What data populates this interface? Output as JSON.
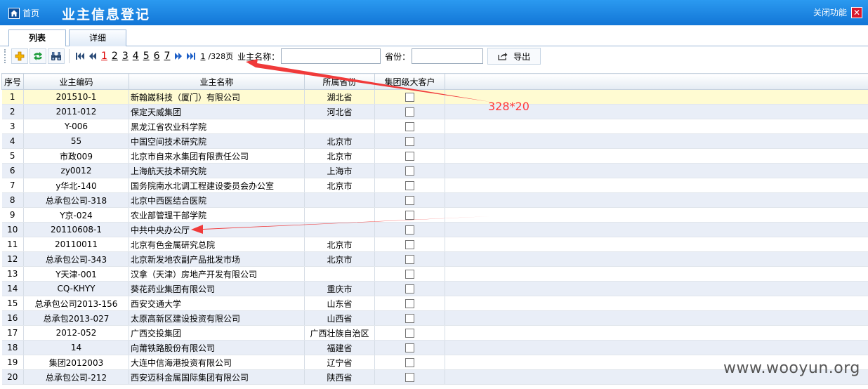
{
  "header": {
    "home_label": "首页",
    "title": "业主信息登记",
    "close_label": "关闭功能",
    "close_glyph": "✕"
  },
  "tabs": [
    {
      "label": "列表",
      "active": true
    },
    {
      "label": "详细",
      "active": false
    }
  ],
  "toolbar": {
    "pages": [
      "1",
      "2",
      "3",
      "4",
      "5",
      "6",
      "7"
    ],
    "current_page": "1",
    "total_pages_text": "/328页",
    "owner_name_label": "业主名称：",
    "owner_name_value": "",
    "province_label": "省份：",
    "province_value": "",
    "export_label": "导出"
  },
  "table": {
    "columns": [
      "序号",
      "业主编码",
      "业主名称",
      "所属省份",
      "集团级大客户"
    ],
    "rows": [
      [
        "1",
        "201510-1",
        "新翰崴科技（厦门）有限公司",
        "湖北省"
      ],
      [
        "2",
        "2011-012",
        "保定天威集团",
        "河北省"
      ],
      [
        "3",
        "Y-006",
        "黑龙江省农业科学院",
        ""
      ],
      [
        "4",
        "55",
        "中国空间技术研究院",
        "北京市"
      ],
      [
        "5",
        "市政009",
        "北京市自来水集团有限责任公司",
        "北京市"
      ],
      [
        "6",
        "zy0012",
        "上海航天技术研究院",
        "上海市"
      ],
      [
        "7",
        "y华北-140",
        "国务院南水北调工程建设委员会办公室",
        "北京市"
      ],
      [
        "8",
        "总承包公司-318",
        "北京中西医结合医院",
        ""
      ],
      [
        "9",
        "Y京-024",
        "农业部管理干部学院",
        ""
      ],
      [
        "10",
        "20110608-1",
        "中共中央办公厅",
        ""
      ],
      [
        "11",
        "20110011",
        "北京有色金属研究总院",
        "北京市"
      ],
      [
        "12",
        "总承包公司-343",
        "北京新发地农副产品批发市场",
        "北京市"
      ],
      [
        "13",
        "Y天津-001",
        "汉拿（天津）房地产开发有限公司",
        ""
      ],
      [
        "14",
        "CQ-KHYY",
        "葵花药业集团有限公司",
        "重庆市"
      ],
      [
        "15",
        "总承包公司2013-156",
        "西安交通大学",
        "山东省"
      ],
      [
        "16",
        "总承包2013-027",
        "太原高新区建设投资有限公司",
        "山西省"
      ],
      [
        "17",
        "2012-052",
        "广西交投集团",
        "广西壮族自治区"
      ],
      [
        "18",
        "14",
        "向莆铁路股份有限公司",
        "福建省"
      ],
      [
        "19",
        "集团2012003",
        "大连中信海港投资有限公司",
        "辽宁省"
      ],
      [
        "20",
        "总承包公司-212",
        "西安迈科金属国际集团有限公司",
        "陕西省"
      ]
    ]
  },
  "annotation": "328*20",
  "watermark": "www.wooyun.org",
  "colors": {
    "titlebar": "#1a84e3",
    "annotation": "#ff3a3a",
    "close": "#d8182b",
    "selected_row": "#fffbd2",
    "alt_row": "#e9eef7"
  }
}
